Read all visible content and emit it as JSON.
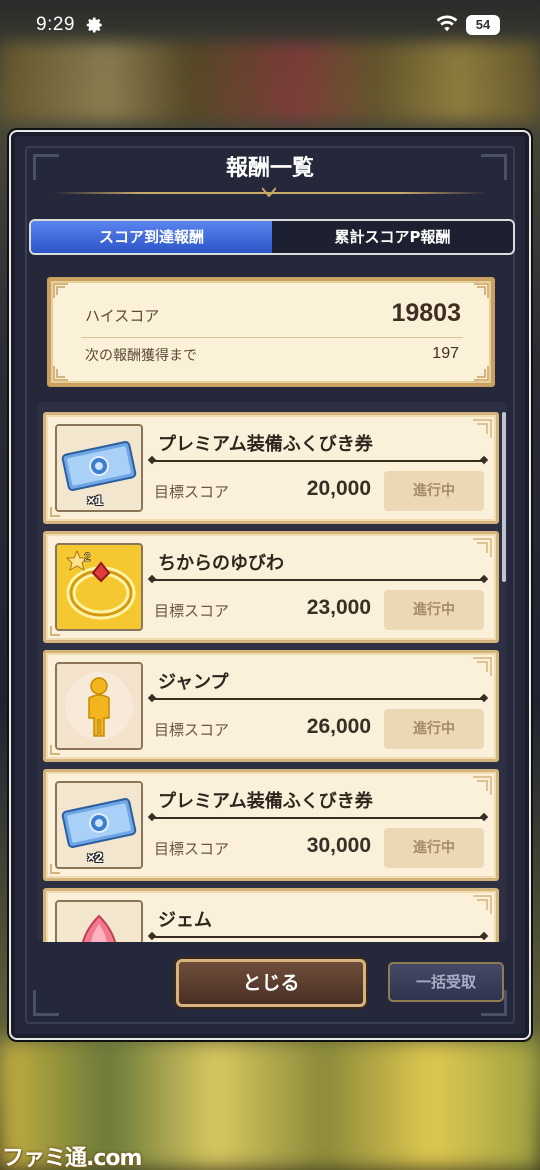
{
  "status_bar": {
    "time": "9:29",
    "battery": "54"
  },
  "modal": {
    "title": "報酬一覧",
    "tabs": [
      {
        "label": "スコア到達報酬",
        "active": true
      },
      {
        "label": "累計スコアP報酬",
        "active": false
      }
    ],
    "score_panel": {
      "high_score_label": "ハイスコア",
      "high_score_value": "19803",
      "next_label": "次の報酬獲得まで",
      "next_value": "197"
    },
    "rewards": [
      {
        "name": "プレミアム装備ふくびき券",
        "target_label": "目標スコア",
        "target_value": "20,000",
        "status": "進行中",
        "quantity": "×1",
        "icon": "ticket-icon"
      },
      {
        "name": "ちからのゆびわ",
        "target_label": "目標スコア",
        "target_value": "23,000",
        "status": "進行中",
        "quantity": "",
        "icon": "ring-icon",
        "rarity_badge": "2"
      },
      {
        "name": "ジャンプ",
        "target_label": "目標スコア",
        "target_value": "26,000",
        "status": "進行中",
        "quantity": "",
        "icon": "jump-figure-icon"
      },
      {
        "name": "プレミアム装備ふくびき券",
        "target_label": "目標スコア",
        "target_value": "30,000",
        "status": "進行中",
        "quantity": "×2",
        "icon": "ticket-icon"
      },
      {
        "name": "ジェム",
        "target_label": "",
        "target_value": "",
        "status": "",
        "quantity": "",
        "icon": "gem-icon"
      }
    ],
    "close_button": "とじる",
    "bulk_receive_button": "一括受取"
  },
  "watermark": "ファミ通.com",
  "colors": {
    "tab_active": "#2c55c8",
    "panel_bg": "#fbf0d8",
    "modal_bg": "#25283a",
    "gold_border": "#c9a062"
  }
}
